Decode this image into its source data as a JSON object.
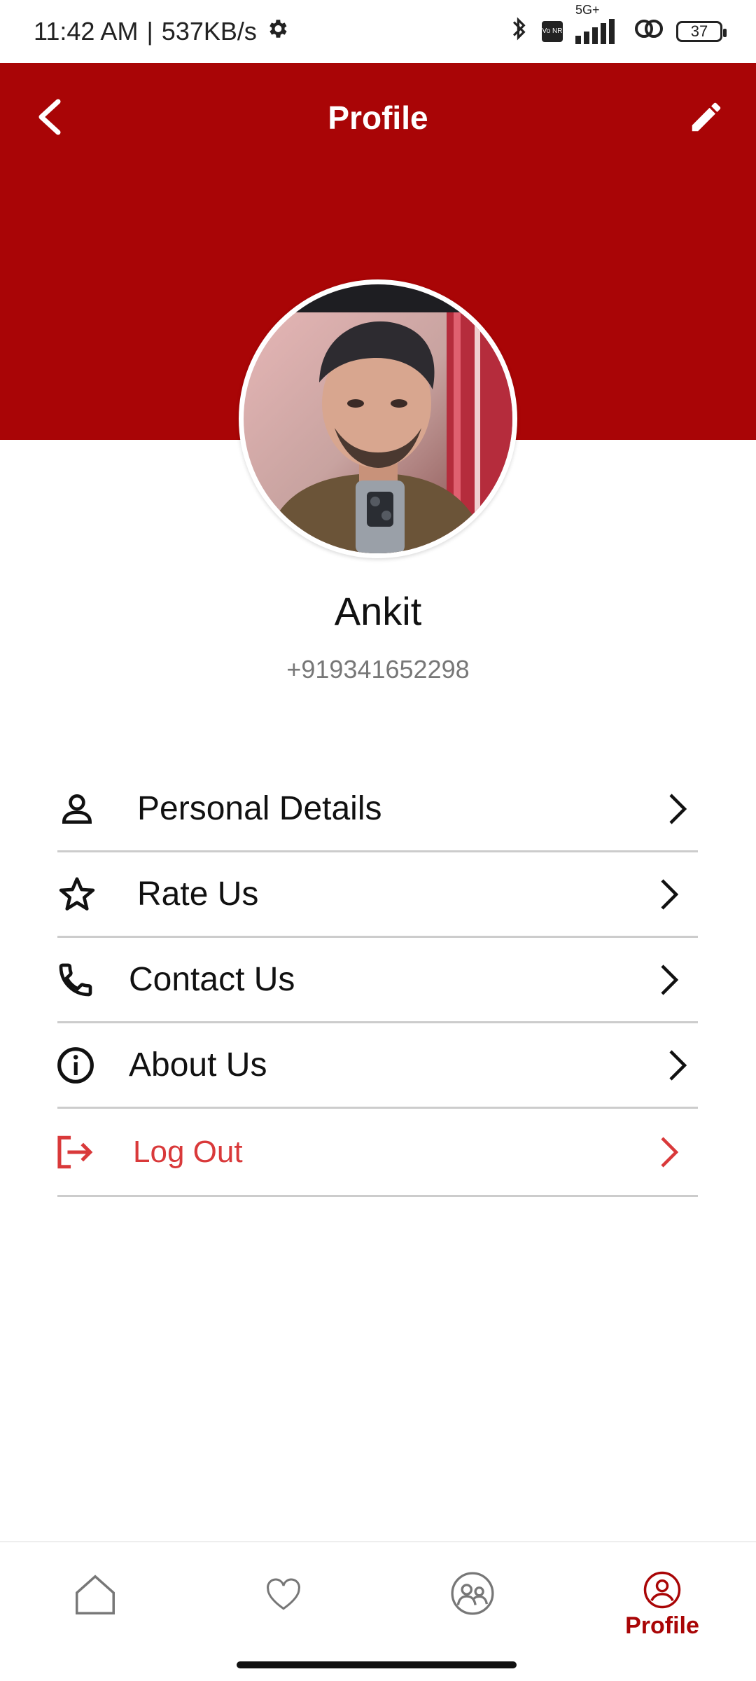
{
  "status_bar": {
    "time": "11:42 AM",
    "separator": "|",
    "net_speed": "537KB/s",
    "network_label": "5G+",
    "volte_label": "Vo NR",
    "battery": "37"
  },
  "header": {
    "title": "Profile",
    "bg_color": "#a90506"
  },
  "profile": {
    "name": "Ankit",
    "phone": "+919341652298"
  },
  "menu": {
    "items": [
      {
        "label": "Personal Details",
        "icon": "person-icon"
      },
      {
        "label": "Rate Us",
        "icon": "star-icon"
      },
      {
        "label": "Contact Us",
        "icon": "phone-icon"
      },
      {
        "label": "About Us",
        "icon": "info-icon"
      },
      {
        "label": "Log Out",
        "icon": "logout-icon",
        "color": "#d9393a"
      }
    ]
  },
  "bottom_nav": {
    "items": [
      {
        "icon": "home-icon"
      },
      {
        "icon": "heart-icon"
      },
      {
        "icon": "users-icon"
      },
      {
        "icon": "profile-icon",
        "label": "Profile",
        "active": true
      }
    ],
    "active_color": "#a90506"
  }
}
